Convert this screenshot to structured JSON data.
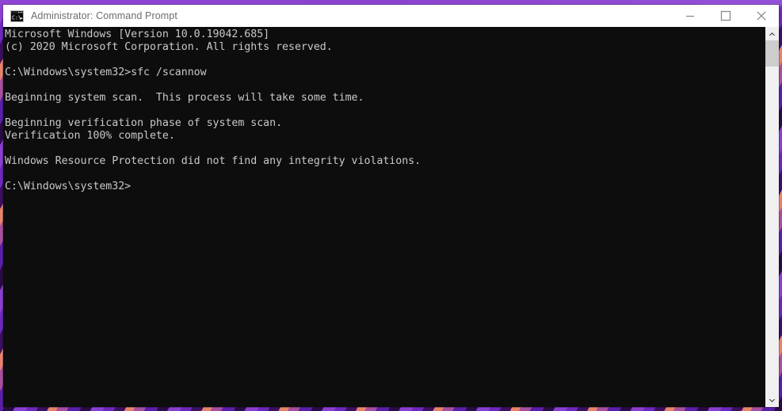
{
  "window": {
    "title": "Administrator: Command Prompt",
    "icon": "command-prompt-icon",
    "controls": {
      "minimize": "Minimize",
      "maximize": "Maximize",
      "close": "Close"
    }
  },
  "terminal": {
    "background_color": "#0d0d0d",
    "text_color": "#c8c8c8",
    "lines": [
      "Microsoft Windows [Version 10.0.19042.685]",
      "(c) 2020 Microsoft Corporation. All rights reserved.",
      "",
      "C:\\Windows\\system32>sfc /scannow",
      "",
      "Beginning system scan.  This process will take some time.",
      "",
      "Beginning verification phase of system scan.",
      "Verification 100% complete.",
      "",
      "Windows Resource Protection did not find any integrity violations.",
      "",
      "C:\\Windows\\system32>"
    ]
  },
  "scrollbar": {
    "up_arrow": "scroll-up-icon",
    "down_arrow": "scroll-down-icon",
    "thumb": "scrollbar-thumb"
  },
  "desktop": {
    "wallpaper_colors": [
      "#8a3fd1",
      "#6d28bf",
      "#3b1060",
      "#e8836b",
      "#a84f9e",
      "#5a1fa8",
      "#2a0b45"
    ],
    "top_band_color": "#8e44d4"
  }
}
